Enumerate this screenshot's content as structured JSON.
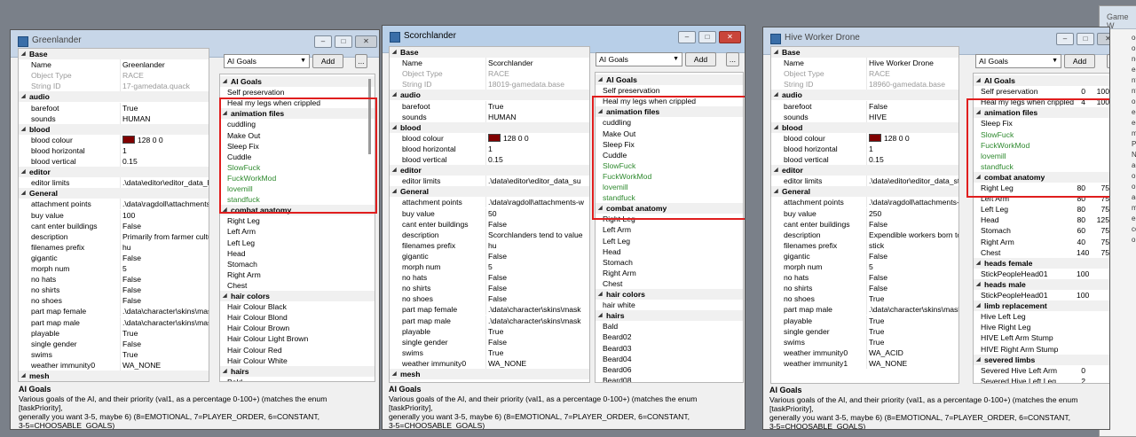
{
  "windows": [
    {
      "title": "Greenlander",
      "props": [
        {
          "t": "c",
          "n": "Base"
        },
        {
          "n": "Name",
          "v": "Greenlander"
        },
        {
          "n": "Object Type",
          "v": "RACE",
          "ro": true
        },
        {
          "n": "String ID",
          "v": "17-gamedata.quack",
          "ro": true
        },
        {
          "t": "c",
          "n": "audio"
        },
        {
          "n": "barefoot",
          "v": "True"
        },
        {
          "n": "sounds",
          "v": "HUMAN"
        },
        {
          "t": "c",
          "n": "blood"
        },
        {
          "n": "blood colour",
          "v": "128 0 0",
          "sw": true
        },
        {
          "n": "blood horizontal",
          "v": "1"
        },
        {
          "n": "blood vertical",
          "v": "0.15"
        },
        {
          "t": "c",
          "n": "editor"
        },
        {
          "n": "editor limits",
          "v": ".\\data\\editor\\editor_data_hu"
        },
        {
          "t": "c",
          "n": "General"
        },
        {
          "n": "attachment points",
          "v": ".\\data\\ragdoll\\attachments-w"
        },
        {
          "n": "buy value",
          "v": "100"
        },
        {
          "n": "cant enter buildings",
          "v": "False"
        },
        {
          "n": "description",
          "v": "Primarily from farmer cultures,"
        },
        {
          "n": "filenames prefix",
          "v": "hu"
        },
        {
          "n": "gigantic",
          "v": "False"
        },
        {
          "n": "morph num",
          "v": "5"
        },
        {
          "n": "no hats",
          "v": "False"
        },
        {
          "n": "no shirts",
          "v": "False"
        },
        {
          "n": "no shoes",
          "v": "False"
        },
        {
          "n": "part map female",
          "v": ".\\data\\character\\skins\\mask"
        },
        {
          "n": "part map male",
          "v": ".\\data\\character\\skins\\mask"
        },
        {
          "n": "playable",
          "v": "True"
        },
        {
          "n": "single gender",
          "v": "False"
        },
        {
          "n": "swims",
          "v": "True"
        },
        {
          "n": "weather immunity0",
          "v": "WA_NONE"
        },
        {
          "t": "c",
          "n": "mesh"
        }
      ],
      "goals_dd": "AI Goals",
      "add": "Add",
      "more": "...",
      "right": [
        {
          "t": "c",
          "n": "AI Goals"
        },
        {
          "n": "Self preservation"
        },
        {
          "n": "Heal my legs when crippled"
        },
        {
          "t": "c",
          "n": "animation files"
        },
        {
          "n": "cuddling"
        },
        {
          "n": "Make Out"
        },
        {
          "n": "Sleep Fix"
        },
        {
          "n": "Cuddle"
        },
        {
          "n": "SlowFuck",
          "g": true
        },
        {
          "n": "FuckWorkMod",
          "g": true
        },
        {
          "n": "lovemill",
          "g": true
        },
        {
          "n": "standfuck",
          "g": true
        },
        {
          "t": "c",
          "n": "combat anatomy"
        },
        {
          "n": "Right Leg"
        },
        {
          "n": "Left Arm"
        },
        {
          "n": "Left Leg"
        },
        {
          "n": "Head"
        },
        {
          "n": "Stomach"
        },
        {
          "n": "Right Arm"
        },
        {
          "n": "Chest"
        },
        {
          "t": "c",
          "n": "hair colors"
        },
        {
          "n": "Hair Colour Black"
        },
        {
          "n": "Hair Colour Blond"
        },
        {
          "n": "Hair Colour Brown"
        },
        {
          "n": "Hair Colour Light Brown"
        },
        {
          "n": "Hair Colour Red"
        },
        {
          "n": "Hair Colour White"
        },
        {
          "t": "c",
          "n": "hairs"
        },
        {
          "n": "Bald"
        }
      ]
    },
    {
      "title": "Scorchlander",
      "props": [
        {
          "t": "c",
          "n": "Base"
        },
        {
          "n": "Name",
          "v": "Scorchlander"
        },
        {
          "n": "Object Type",
          "v": "RACE",
          "ro": true
        },
        {
          "n": "String ID",
          "v": "18019-gamedata.base",
          "ro": true
        },
        {
          "t": "c",
          "n": "audio"
        },
        {
          "n": "barefoot",
          "v": "True"
        },
        {
          "n": "sounds",
          "v": "HUMAN"
        },
        {
          "t": "c",
          "n": "blood"
        },
        {
          "n": "blood colour",
          "v": "128 0 0",
          "sw": true
        },
        {
          "n": "blood horizontal",
          "v": "1"
        },
        {
          "n": "blood vertical",
          "v": "0.15"
        },
        {
          "t": "c",
          "n": "editor"
        },
        {
          "n": "editor limits",
          "v": ".\\data\\editor\\editor_data_su"
        },
        {
          "t": "c",
          "n": "General"
        },
        {
          "n": "attachment points",
          "v": ".\\data\\ragdoll\\attachments-w"
        },
        {
          "n": "buy value",
          "v": "50"
        },
        {
          "n": "cant enter buildings",
          "v": "False"
        },
        {
          "n": "description",
          "v": "Scorchlanders tend to value"
        },
        {
          "n": "filenames prefix",
          "v": "hu"
        },
        {
          "n": "gigantic",
          "v": "False"
        },
        {
          "n": "morph num",
          "v": "5"
        },
        {
          "n": "no hats",
          "v": "False"
        },
        {
          "n": "no shirts",
          "v": "False"
        },
        {
          "n": "no shoes",
          "v": "False"
        },
        {
          "n": "part map female",
          "v": ".\\data\\character\\skins\\mask"
        },
        {
          "n": "part map male",
          "v": ".\\data\\character\\skins\\mask"
        },
        {
          "n": "playable",
          "v": "True"
        },
        {
          "n": "single gender",
          "v": "False"
        },
        {
          "n": "swims",
          "v": "True"
        },
        {
          "n": "weather immunity0",
          "v": "WA_NONE"
        },
        {
          "t": "c",
          "n": "mesh"
        }
      ],
      "goals_dd": "AI Goals",
      "add": "Add",
      "more": "...",
      "right": [
        {
          "t": "c",
          "n": "AI Goals"
        },
        {
          "n": "Self preservation"
        },
        {
          "n": "Heal my legs when crippled"
        },
        {
          "t": "c",
          "n": "animation files"
        },
        {
          "n": "cuddling"
        },
        {
          "n": "Make Out"
        },
        {
          "n": "Sleep Fix"
        },
        {
          "n": "Cuddle"
        },
        {
          "n": "SlowFuck",
          "g": true
        },
        {
          "n": "FuckWorkMod",
          "g": true
        },
        {
          "n": "lovemill",
          "g": true
        },
        {
          "n": "standfuck",
          "g": true
        },
        {
          "t": "c",
          "n": "combat anatomy"
        },
        {
          "n": "Right Leg"
        },
        {
          "n": "Left Arm"
        },
        {
          "n": "Left Leg"
        },
        {
          "n": "Head"
        },
        {
          "n": "Stomach"
        },
        {
          "n": "Right Arm"
        },
        {
          "n": "Chest"
        },
        {
          "t": "c",
          "n": "hair colors"
        },
        {
          "n": "hair white"
        },
        {
          "t": "c",
          "n": "hairs"
        },
        {
          "n": "Bald"
        },
        {
          "n": "Beard02"
        },
        {
          "n": "Beard03"
        },
        {
          "n": "Beard04"
        },
        {
          "n": "Beard06"
        },
        {
          "n": "Beard08"
        }
      ]
    },
    {
      "title": "Hive Worker Drone",
      "props": [
        {
          "t": "c",
          "n": "Base"
        },
        {
          "n": "Name",
          "v": "Hive Worker Drone"
        },
        {
          "n": "Object Type",
          "v": "RACE",
          "ro": true
        },
        {
          "n": "String ID",
          "v": "18960-gamedata.base",
          "ro": true
        },
        {
          "t": "c",
          "n": "audio"
        },
        {
          "n": "barefoot",
          "v": "False"
        },
        {
          "n": "sounds",
          "v": "HIVE"
        },
        {
          "t": "c",
          "n": "blood"
        },
        {
          "n": "blood colour",
          "v": "128 0 0",
          "sw": true
        },
        {
          "n": "blood horizontal",
          "v": "1"
        },
        {
          "n": "blood vertical",
          "v": "0.15"
        },
        {
          "t": "c",
          "n": "editor"
        },
        {
          "n": "editor limits",
          "v": ".\\data\\editor\\editor_data_sti"
        },
        {
          "t": "c",
          "n": "General"
        },
        {
          "n": "attachment points",
          "v": ".\\data\\ragdoll\\attachments-w"
        },
        {
          "n": "buy value",
          "v": "250"
        },
        {
          "n": "cant enter buildings",
          "v": "False"
        },
        {
          "n": "description",
          "v": "Expendible workers born to la"
        },
        {
          "n": "filenames prefix",
          "v": "stick"
        },
        {
          "n": "gigantic",
          "v": "False"
        },
        {
          "n": "morph num",
          "v": "5"
        },
        {
          "n": "no hats",
          "v": "False"
        },
        {
          "n": "no shirts",
          "v": "False"
        },
        {
          "n": "no shoes",
          "v": "True"
        },
        {
          "n": "part map male",
          "v": ".\\data\\character\\skins\\mask"
        },
        {
          "n": "playable",
          "v": "True"
        },
        {
          "n": "single gender",
          "v": "True"
        },
        {
          "n": "swims",
          "v": "True"
        },
        {
          "n": "weather immunity0",
          "v": "WA_ACID"
        },
        {
          "n": "weather immunity1",
          "v": "WA_NONE"
        }
      ],
      "goals_dd": "AI Goals",
      "add": "Add",
      "more": "...",
      "right": [
        {
          "t": "c",
          "n": "AI Goals"
        },
        {
          "n": "Self preservation",
          "a": "0",
          "b": "100"
        },
        {
          "n": "Heal my legs when crippled",
          "a": "4",
          "b": "100"
        },
        {
          "t": "c",
          "n": "animation files"
        },
        {
          "n": "Sleep Fix"
        },
        {
          "n": "SlowFuck",
          "g": true
        },
        {
          "n": "FuckWorkMod",
          "g": true
        },
        {
          "n": "lovemill",
          "g": true
        },
        {
          "n": "standfuck",
          "g": true
        },
        {
          "t": "c",
          "n": "combat anatomy"
        },
        {
          "n": "Right Leg",
          "a": "80",
          "b": "75"
        },
        {
          "n": "Left Arm",
          "a": "80",
          "b": "75"
        },
        {
          "n": "Left Leg",
          "a": "80",
          "b": "75"
        },
        {
          "n": "Head",
          "a": "80",
          "b": "125"
        },
        {
          "n": "Stomach",
          "a": "60",
          "b": "75"
        },
        {
          "n": "Right Arm",
          "a": "40",
          "b": "75"
        },
        {
          "n": "Chest",
          "a": "140",
          "b": "75"
        },
        {
          "t": "c",
          "n": "heads female"
        },
        {
          "n": "StickPeopleHead01",
          "a": "100"
        },
        {
          "t": "c",
          "n": "heads male"
        },
        {
          "n": "StickPeopleHead01",
          "a": "100"
        },
        {
          "t": "c",
          "n": "limb replacement"
        },
        {
          "n": "Hive Left Leg"
        },
        {
          "n": "Hive Right Leg"
        },
        {
          "n": "HIVE Left Arm Stump"
        },
        {
          "n": "HIVE Right Arm Stump"
        },
        {
          "t": "c",
          "n": "severed limbs"
        },
        {
          "n": "Severed Hive Left Arm",
          "a": "0"
        },
        {
          "n": "Severed Hive Left Leg",
          "a": "2"
        }
      ]
    }
  ],
  "desc": {
    "title": "AI Goals",
    "body": "Various goals of the AI, and their priority (val1, as a percentage 0-100+) (matches the enum [taskPriority],\ngenerally you want 3-5, maybe 6) (8=EMOTIONAL, 7=PLAYER_ORDER, 6=CONSTANT,\n3-5=CHOOSABLE_GOALS)"
  },
  "caption_buttons": {
    "min": "–",
    "max": "□",
    "close": "✕"
  },
  "background_window": {
    "title": "Game W",
    "lines": [
      "oc",
      "olc",
      "nd",
      "ec",
      "nt",
      "nt",
      "ob",
      "ec",
      "ed",
      "m",
      "Pa",
      "Ne",
      "ac",
      "obj",
      "ol",
      "ac",
      "m",
      "ec",
      "cc",
      "ol"
    ]
  },
  "colors": {
    "highlight": "#e01e1e",
    "green_text": "#2f8a2f",
    "blood_swatch": "#800000"
  }
}
